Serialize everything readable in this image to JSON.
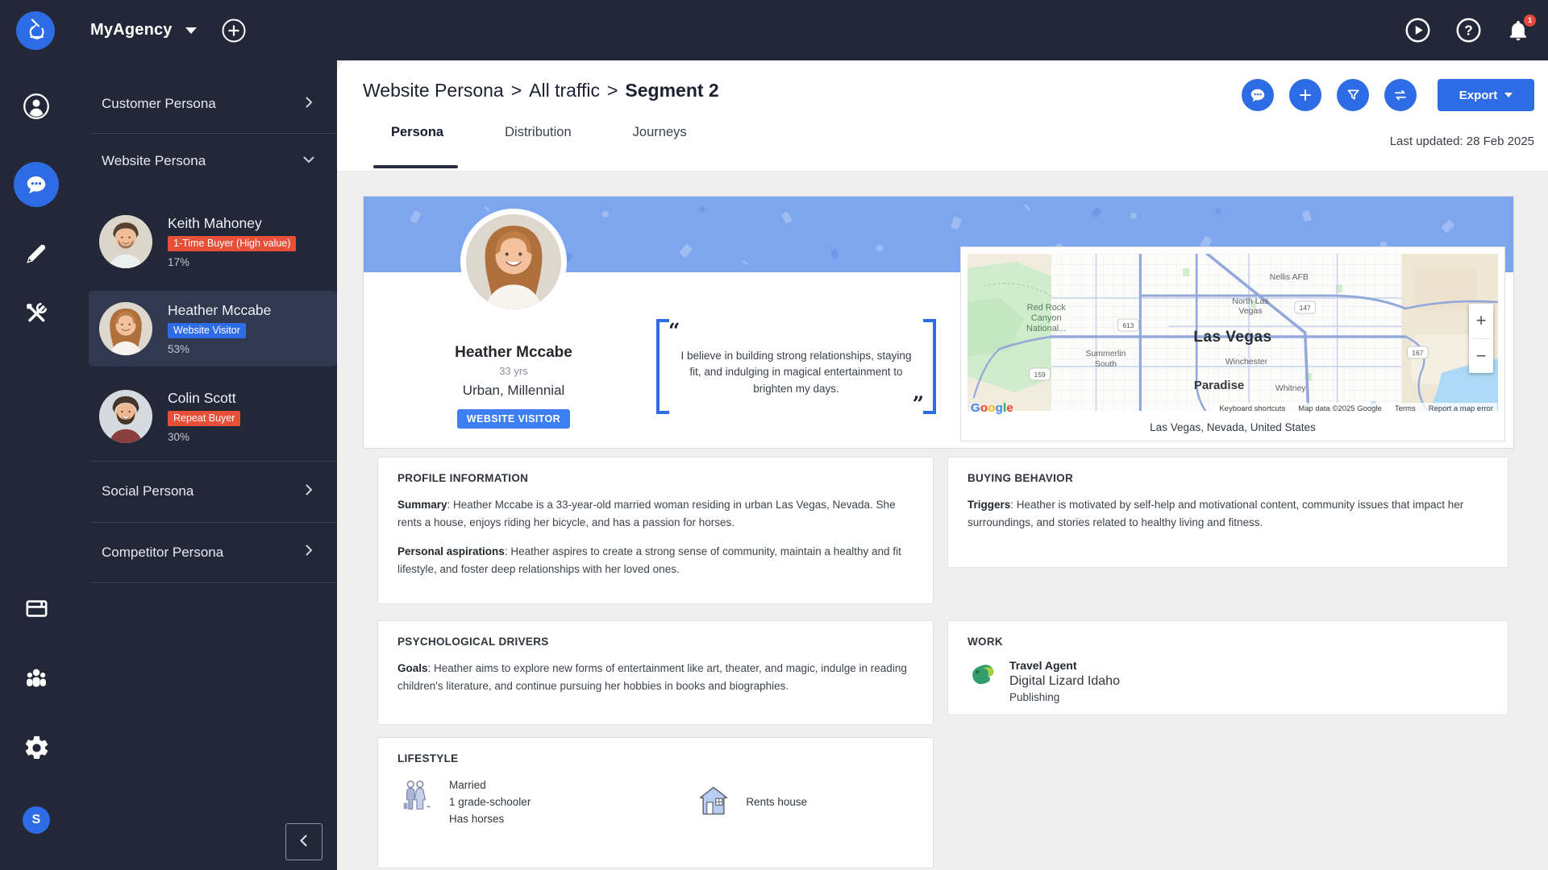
{
  "colors": {
    "navy": "#232838",
    "accent": "#2d6ce5",
    "badge_red": "#e84f39",
    "badge_blue": "#2d6ce5",
    "band": "#7ea6ee",
    "content_bg": "#efeff0",
    "selected_item": "#313950"
  },
  "topbar": {
    "brand": "MyAgency",
    "notifications": "1",
    "user_initial": "S"
  },
  "sidebar": {
    "customer": "Customer Persona",
    "website": "Website Persona",
    "social": "Social Persona",
    "competitor": "Competitor Persona",
    "personas": [
      {
        "name": "Keith Mahoney",
        "badge": "1-Time Buyer (High value)",
        "percent": "17%"
      },
      {
        "name": "Heather Mccabe",
        "badge": "Website Visitor",
        "percent": "53%"
      },
      {
        "name": "Colin Scott",
        "badge": "Repeat Buyer",
        "percent": "30%"
      }
    ]
  },
  "header": {
    "breadcrumb": [
      "Website Persona",
      "All traffic",
      "Segment 2"
    ],
    "separator": ">",
    "tabs": [
      "Persona",
      "Distribution",
      "Journeys"
    ],
    "export_label": "Export",
    "last_updated": "Last updated: 28 Feb 2025"
  },
  "persona": {
    "name": "Heather Mccabe",
    "age": "33 yrs",
    "segment": "Urban, Millennial",
    "badge": "WEBSITE VISITOR",
    "quote_open": "“",
    "quote": "I believe in building strong relationships, staying fit, and indulging in magical entertainment to brighten my days.",
    "quote_close": "”",
    "location": "Las Vegas, Nevada, United States"
  },
  "map": {
    "city": "Las Vegas",
    "labels": {
      "nellis": "Nellis AFB",
      "north_las_1": "North Las",
      "north_las_2": "Vegas",
      "winchester": "Winchester",
      "paradise": "Paradise",
      "whitney": "Whitney",
      "summerlin_1": "Summerlin",
      "summerlin_2": "South",
      "red_rock_1": "Red Rock",
      "red_rock_2": "Canyon",
      "red_rock_3": "National..."
    },
    "shields": [
      "613",
      "147",
      "167",
      "159"
    ],
    "google": [
      "G",
      "o",
      "o",
      "g",
      "l",
      "e"
    ],
    "attribution": [
      "Keyboard shortcuts",
      "Map data ©2025 Google",
      "Terms",
      "Report a map error"
    ],
    "zoom_in": "+",
    "zoom_out": "−"
  },
  "cards": {
    "profile": {
      "title": "PROFILE INFORMATION",
      "summary_label": "Summary",
      "summary_text": ": Heather Mccabe is a 33-year-old married woman residing in urban Las Vegas, Nevada. She rents a house, enjoys riding her bicycle, and has a passion for horses.",
      "aspirations_label": "Personal aspirations",
      "aspirations_text": ": Heather aspires to create a strong sense of community, maintain a healthy and fit lifestyle, and foster deep relationships with her loved ones."
    },
    "buying": {
      "title": "BUYING BEHAVIOR",
      "triggers_label": "Triggers",
      "triggers_text": ": Heather is motivated by self-help and motivational content, community issues that impact her surroundings, and stories related to healthy living and fitness."
    },
    "psych": {
      "title": "PSYCHOLOGICAL DRIVERS",
      "goals_label": "Goals",
      "goals_text": ": Heather aims to explore new forms of entertainment like art, theater, and magic, indulge in reading children's literature, and continue pursuing her hobbies in books and biographies."
    },
    "work": {
      "title": "WORK",
      "role": "Travel Agent",
      "company": "Digital Lizard Idaho",
      "industry": "Publishing"
    },
    "lifestyle": {
      "title": "LIFESTYLE",
      "family": [
        "Married",
        "1 grade-schooler",
        "Has horses"
      ],
      "housing": "Rents house"
    }
  }
}
